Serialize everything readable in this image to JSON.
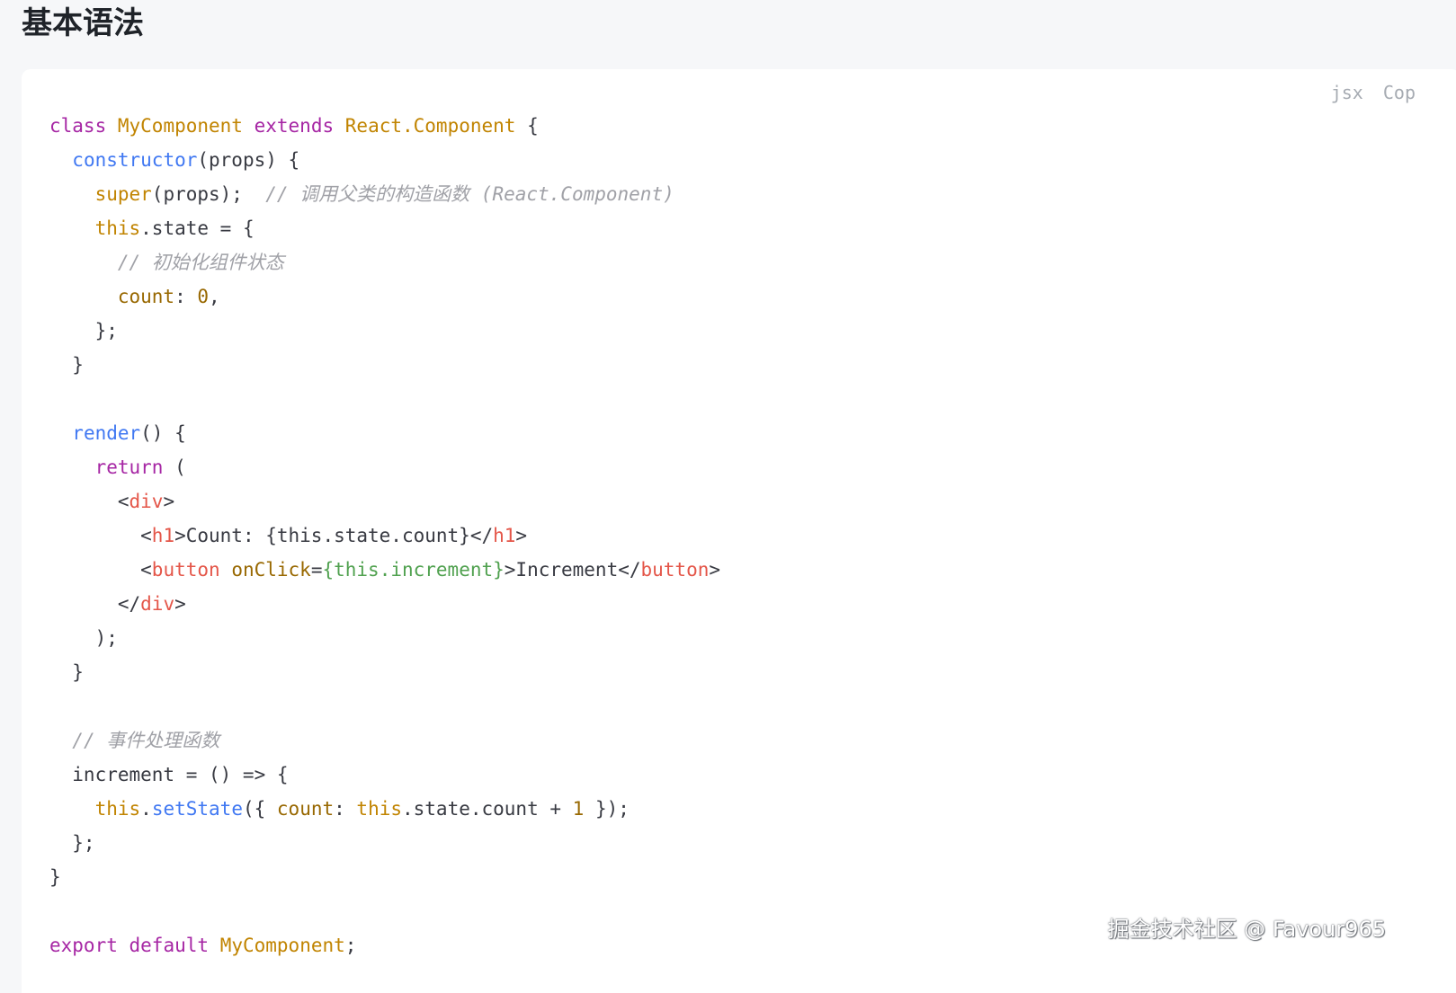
{
  "page": {
    "heading": "基本语法"
  },
  "code_block": {
    "language": "jsx",
    "copy_label": "Cop",
    "lines": [
      [
        {
          "t": "kw",
          "v": "class"
        },
        {
          "t": "plain",
          "v": " "
        },
        {
          "t": "cls",
          "v": "MyComponent"
        },
        {
          "t": "plain",
          "v": " "
        },
        {
          "t": "kw",
          "v": "extends"
        },
        {
          "t": "plain",
          "v": " "
        },
        {
          "t": "cls",
          "v": "React.Component"
        },
        {
          "t": "plain",
          "v": " {"
        }
      ],
      [
        {
          "t": "plain",
          "v": "  "
        },
        {
          "t": "fn",
          "v": "constructor"
        },
        {
          "t": "plain",
          "v": "(props) {"
        }
      ],
      [
        {
          "t": "plain",
          "v": "    "
        },
        {
          "t": "self",
          "v": "super"
        },
        {
          "t": "plain",
          "v": "(props);  "
        },
        {
          "t": "cmt",
          "v": "// 调用父类的构造函数 (React.Component)"
        }
      ],
      [
        {
          "t": "plain",
          "v": "    "
        },
        {
          "t": "self",
          "v": "this"
        },
        {
          "t": "plain",
          "v": ".state = {"
        }
      ],
      [
        {
          "t": "plain",
          "v": "      "
        },
        {
          "t": "cmt",
          "v": "// 初始化组件状态"
        }
      ],
      [
        {
          "t": "plain",
          "v": "      "
        },
        {
          "t": "prop",
          "v": "count"
        },
        {
          "t": "plain",
          "v": ": "
        },
        {
          "t": "num",
          "v": "0"
        },
        {
          "t": "plain",
          "v": ","
        }
      ],
      [
        {
          "t": "plain",
          "v": "    };"
        }
      ],
      [
        {
          "t": "plain",
          "v": "  }"
        }
      ],
      [],
      [
        {
          "t": "plain",
          "v": "  "
        },
        {
          "t": "fn",
          "v": "render"
        },
        {
          "t": "plain",
          "v": "() {"
        }
      ],
      [
        {
          "t": "plain",
          "v": "    "
        },
        {
          "t": "kw",
          "v": "return"
        },
        {
          "t": "plain",
          "v": " ("
        }
      ],
      [
        {
          "t": "plain",
          "v": "      <"
        },
        {
          "t": "tag",
          "v": "div"
        },
        {
          "t": "plain",
          "v": ">"
        }
      ],
      [
        {
          "t": "plain",
          "v": "        <"
        },
        {
          "t": "tag",
          "v": "h1"
        },
        {
          "t": "plain",
          "v": ">Count: {this.state.count}</"
        },
        {
          "t": "tag",
          "v": "h1"
        },
        {
          "t": "plain",
          "v": ">"
        }
      ],
      [
        {
          "t": "plain",
          "v": "        <"
        },
        {
          "t": "tag",
          "v": "button"
        },
        {
          "t": "plain",
          "v": " "
        },
        {
          "t": "attr",
          "v": "onClick"
        },
        {
          "t": "plain",
          "v": "="
        },
        {
          "t": "expr",
          "v": "{this.increment}"
        },
        {
          "t": "plain",
          "v": ">Increment</"
        },
        {
          "t": "tag",
          "v": "button"
        },
        {
          "t": "plain",
          "v": ">"
        }
      ],
      [
        {
          "t": "plain",
          "v": "      </"
        },
        {
          "t": "tag",
          "v": "div"
        },
        {
          "t": "plain",
          "v": ">"
        }
      ],
      [
        {
          "t": "plain",
          "v": "    );"
        }
      ],
      [
        {
          "t": "plain",
          "v": "  }"
        }
      ],
      [],
      [
        {
          "t": "plain",
          "v": "  "
        },
        {
          "t": "cmt",
          "v": "// 事件处理函数"
        }
      ],
      [
        {
          "t": "plain",
          "v": "  increment = () => {"
        }
      ],
      [
        {
          "t": "plain",
          "v": "    "
        },
        {
          "t": "self",
          "v": "this"
        },
        {
          "t": "plain",
          "v": "."
        },
        {
          "t": "fn",
          "v": "setState"
        },
        {
          "t": "plain",
          "v": "({ "
        },
        {
          "t": "prop",
          "v": "count"
        },
        {
          "t": "plain",
          "v": ": "
        },
        {
          "t": "self",
          "v": "this"
        },
        {
          "t": "plain",
          "v": ".state.count + "
        },
        {
          "t": "num",
          "v": "1"
        },
        {
          "t": "plain",
          "v": " });"
        }
      ],
      [
        {
          "t": "plain",
          "v": "  };"
        }
      ],
      [
        {
          "t": "plain",
          "v": "}"
        }
      ],
      [],
      [
        {
          "t": "kw",
          "v": "export"
        },
        {
          "t": "plain",
          "v": " "
        },
        {
          "t": "kw",
          "v": "default"
        },
        {
          "t": "plain",
          "v": " "
        },
        {
          "t": "cls",
          "v": "MyComponent"
        },
        {
          "t": "plain",
          "v": ";"
        }
      ]
    ]
  },
  "watermark": {
    "text": "掘金技术社区 @ Favour965"
  }
}
